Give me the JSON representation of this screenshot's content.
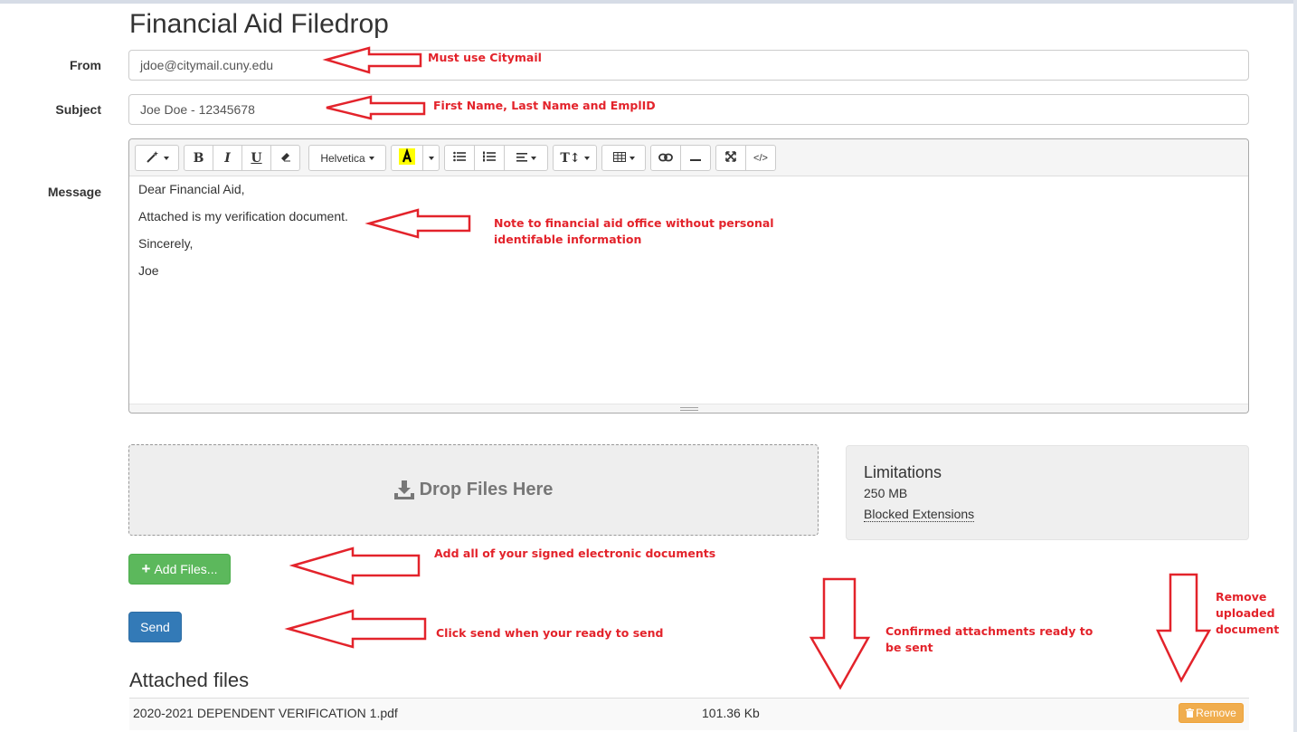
{
  "page": {
    "title": "Financial Aid Filedrop"
  },
  "form": {
    "from_label": "From",
    "from_value": "jdoe@citymail.cuny.edu",
    "subject_label": "Subject",
    "subject_value": "Joe Doe - 12345678",
    "message_label": "Message"
  },
  "toolbar": {
    "font_name": "Helvetica"
  },
  "message": {
    "lines": [
      "Dear Financial Aid,",
      "Attached is my verification document.",
      "Sincerely,",
      "Joe"
    ]
  },
  "upload": {
    "dropzone_text": "Drop Files Here",
    "limitations_title": "Limitations",
    "max_size": "250 MB",
    "blocked_extensions": "Blocked Extensions",
    "add_files_label": "Add Files...",
    "send_label": "Send"
  },
  "attached": {
    "title": "Attached files",
    "files": [
      {
        "name": "2020-2021 DEPENDENT VERIFICATION 1.pdf",
        "size": "101.36 Kb",
        "remove_label": "Remove"
      }
    ]
  },
  "annotations": {
    "citymail": "Must use Citymail",
    "subject_hint": "First Name, Last Name and EmplID",
    "note_line1": "Note to financial aid office without personal",
    "note_line2": "identifable information",
    "add_docs": "Add all of your signed electronic documents",
    "send_hint": "Click send when your ready to send",
    "confirmed_line1": "Confirmed attachments ready to",
    "confirmed_line2": "be sent",
    "remove_line1": "Remove",
    "remove_line2": "uploaded",
    "remove_line3": "document"
  },
  "colors": {
    "annotation_red": "#e3232b",
    "add_button_green": "#5cb85c",
    "send_button_blue": "#337ab7",
    "remove_button_orange": "#f0ad4e"
  }
}
